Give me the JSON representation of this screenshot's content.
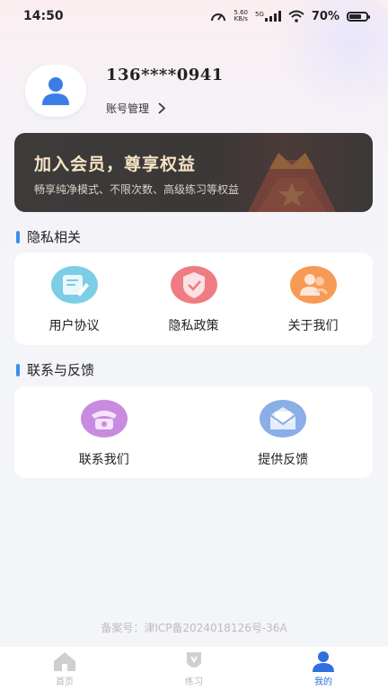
{
  "status_bar": {
    "time": "14:50",
    "net_speed_value": "5.60",
    "net_speed_unit": "KB/s",
    "network": "5G",
    "battery": "70%"
  },
  "profile": {
    "phone": "136****0941",
    "account_label": "账号管理"
  },
  "vip": {
    "title": "加入会员，尊享权益",
    "subtitle": "畅享纯净模式、不限次数、高级练习等权益"
  },
  "privacy_section": {
    "title": "隐私相关",
    "items": [
      {
        "label": "用户协议",
        "icon": "document-icon"
      },
      {
        "label": "隐私政策",
        "icon": "shield-icon"
      },
      {
        "label": "关于我们",
        "icon": "people-icon"
      }
    ]
  },
  "contact_section": {
    "title": "联系与反馈",
    "items": [
      {
        "label": "联系我们",
        "icon": "phone-icon"
      },
      {
        "label": "提供反馈",
        "icon": "mail-icon"
      }
    ]
  },
  "icp": "备案号：津ICP备2024018126号-36A",
  "tabbar": {
    "items": [
      {
        "label": "首页",
        "icon": "home-icon",
        "active": false
      },
      {
        "label": "练习",
        "icon": "practice-icon",
        "active": false
      },
      {
        "label": "我的",
        "icon": "user-icon",
        "active": true
      }
    ]
  },
  "colors": {
    "accent": "#3c8ef0",
    "vip_text": "#f5e3c4",
    "active_tab": "#2f6fe0"
  }
}
